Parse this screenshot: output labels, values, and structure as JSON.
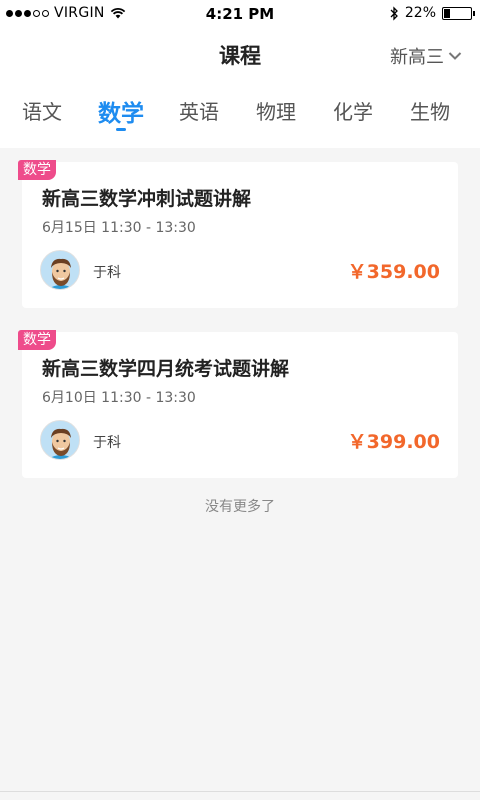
{
  "status_bar": {
    "carrier": "VIRGIN",
    "time": "4:21 PM",
    "battery": "22%",
    "battery_level": 0.22
  },
  "nav": {
    "title": "课程",
    "grade_selector": "新高三"
  },
  "tabs": [
    {
      "label": "语文",
      "active": false
    },
    {
      "label": "数学",
      "active": true
    },
    {
      "label": "英语",
      "active": false
    },
    {
      "label": "物理",
      "active": false
    },
    {
      "label": "化学",
      "active": false
    },
    {
      "label": "生物",
      "active": false
    }
  ],
  "courses": [
    {
      "badge": "数学",
      "title": "新高三数学冲刺试题讲解",
      "time": "6月15日 11:30 - 13:30",
      "teacher": "于科",
      "price": "￥359.00"
    },
    {
      "badge": "数学",
      "title": "新高三数学四月统考试题讲解",
      "time": "6月10日 11:30 - 13:30",
      "teacher": "于科",
      "price": "￥399.00"
    }
  ],
  "footer": {
    "no_more": "没有更多了"
  },
  "colors": {
    "accent": "#1e8cf0",
    "badge": "#ee4c8b",
    "price": "#f2672b"
  }
}
